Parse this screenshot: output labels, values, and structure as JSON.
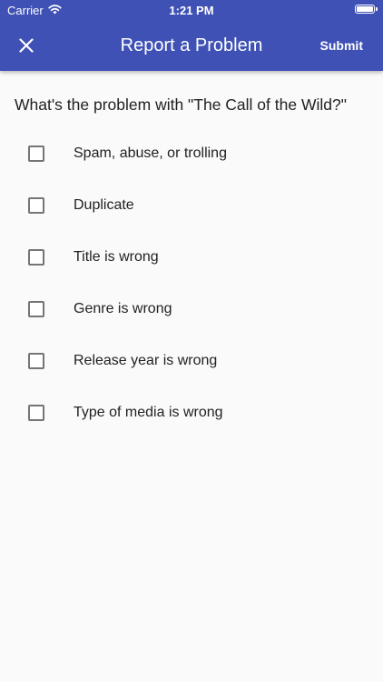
{
  "status_bar": {
    "carrier": "Carrier",
    "time": "1:21 PM"
  },
  "nav": {
    "title": "Report a Problem",
    "submit_label": "Submit"
  },
  "question": "What's the problem with \"The Call of the Wild?\"",
  "options": [
    {
      "label": "Spam, abuse, or trolling",
      "checked": false
    },
    {
      "label": "Duplicate",
      "checked": false
    },
    {
      "label": "Title is wrong",
      "checked": false
    },
    {
      "label": "Genre is wrong",
      "checked": false
    },
    {
      "label": "Release year is wrong",
      "checked": false
    },
    {
      "label": "Type of media is wrong",
      "checked": false
    }
  ],
  "colors": {
    "app_bar": "#3f51b5",
    "background": "#fafafa",
    "checkbox_border": "#757575"
  },
  "icons": {
    "close": "close-icon",
    "wifi": "wifi-icon",
    "battery": "battery-icon"
  }
}
